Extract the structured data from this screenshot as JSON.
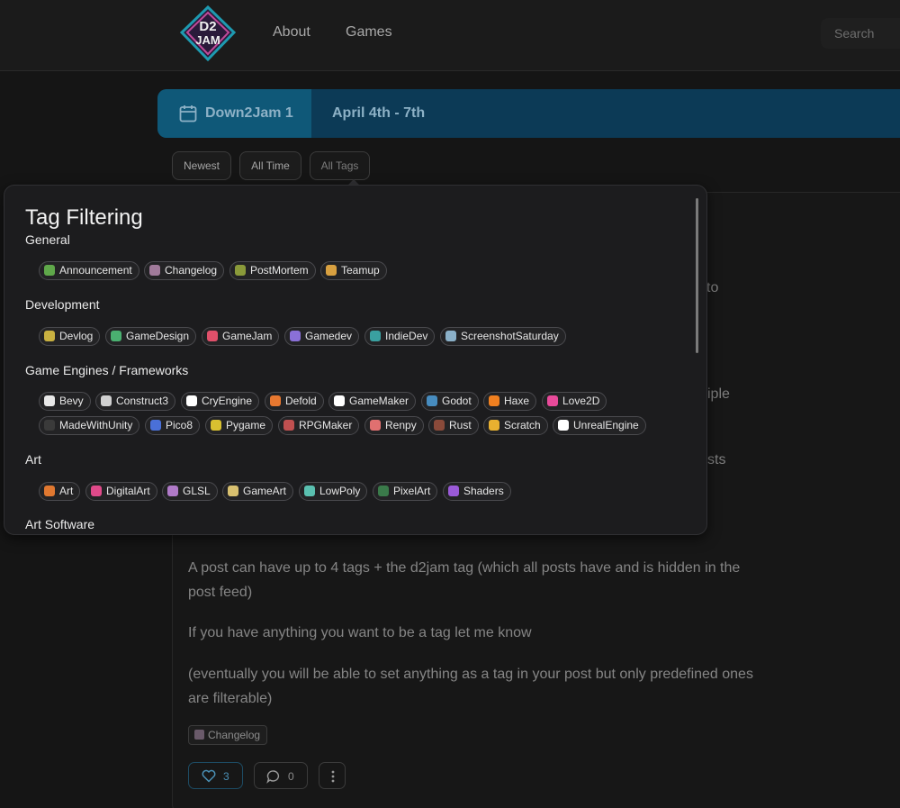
{
  "nav": {
    "logo_text": "D2 JAM",
    "links": [
      "About",
      "Games"
    ],
    "search_placeholder": "Search"
  },
  "banner": {
    "event_name": "Down2Jam 1",
    "dates": "April 4th - 7th"
  },
  "filters": {
    "newest": "Newest",
    "all_time": "All Time",
    "all_tags": "All Tags"
  },
  "popover": {
    "title": "Tag Filtering",
    "sections": [
      {
        "name": "General",
        "tags": [
          {
            "label": "Announcement",
            "color": "#5fa84a"
          },
          {
            "label": "Changelog",
            "color": "#a07a9a"
          },
          {
            "label": "PostMortem",
            "color": "#8a9a3a"
          },
          {
            "label": "Teamup",
            "color": "#d8a040"
          }
        ]
      },
      {
        "name": "Development",
        "tags": [
          {
            "label": "Devlog",
            "color": "#c8b040"
          },
          {
            "label": "GameDesign",
            "color": "#4ab070"
          },
          {
            "label": "GameJam",
            "color": "#e0506a"
          },
          {
            "label": "Gamedev",
            "color": "#8a70d8"
          },
          {
            "label": "IndieDev",
            "color": "#3aa0a0"
          },
          {
            "label": "ScreenshotSaturday",
            "color": "#8ab0c8"
          }
        ]
      },
      {
        "name": "Game Engines / Frameworks",
        "tags": [
          {
            "label": "Bevy",
            "color": "#e8e8e8"
          },
          {
            "label": "Construct3",
            "color": "#d0d0d0"
          },
          {
            "label": "CryEngine",
            "color": "#ffffff"
          },
          {
            "label": "Defold",
            "color": "#e87830"
          },
          {
            "label": "GameMaker",
            "color": "#ffffff"
          },
          {
            "label": "Godot",
            "color": "#478cbf"
          },
          {
            "label": "Haxe",
            "color": "#f08020"
          },
          {
            "label": "Love2D",
            "color": "#e84a9a"
          },
          {
            "label": "MadeWithUnity",
            "color": "#3a3a3a"
          },
          {
            "label": "Pico8",
            "color": "#4a70d8"
          },
          {
            "label": "Pygame",
            "color": "#d8c030"
          },
          {
            "label": "RPGMaker",
            "color": "#c05050"
          },
          {
            "label": "Renpy",
            "color": "#e07070"
          },
          {
            "label": "Rust",
            "color": "#8a4a3a"
          },
          {
            "label": "Scratch",
            "color": "#e8b030"
          },
          {
            "label": "UnrealEngine",
            "color": "#ffffff"
          }
        ]
      },
      {
        "name": "Art",
        "tags": [
          {
            "label": "Art",
            "color": "#e07830"
          },
          {
            "label": "DigitalArt",
            "color": "#e04a8a"
          },
          {
            "label": "GLSL",
            "color": "#b07ac8"
          },
          {
            "label": "GameArt",
            "color": "#d8c070"
          },
          {
            "label": "LowPoly",
            "color": "#5ac0b0"
          },
          {
            "label": "PixelArt",
            "color": "#3a7a4a"
          },
          {
            "label": "Shaders",
            "color": "#9a5ad8"
          }
        ]
      },
      {
        "name": "Art Software",
        "tags": []
      }
    ]
  },
  "post": {
    "fragments": [
      "to",
      "iple",
      "sts"
    ],
    "paragraphs": [
      "A post can have up to 4 tags + the d2jam tag (which all posts have and is hidden in the post feed)",
      "If you have anything you want to be a tag let me know",
      "(eventually you will be able to set anything as a tag in your post but only predefined ones are filterable)"
    ],
    "tag": "Changelog",
    "likes": "3",
    "comments": "0"
  },
  "colors": {
    "background": "#151515",
    "popover_bg": "#1c1c1e",
    "banner_left": "#0f5878",
    "banner_right": "#0c3a56",
    "like_accent": "#4a8fb4"
  }
}
